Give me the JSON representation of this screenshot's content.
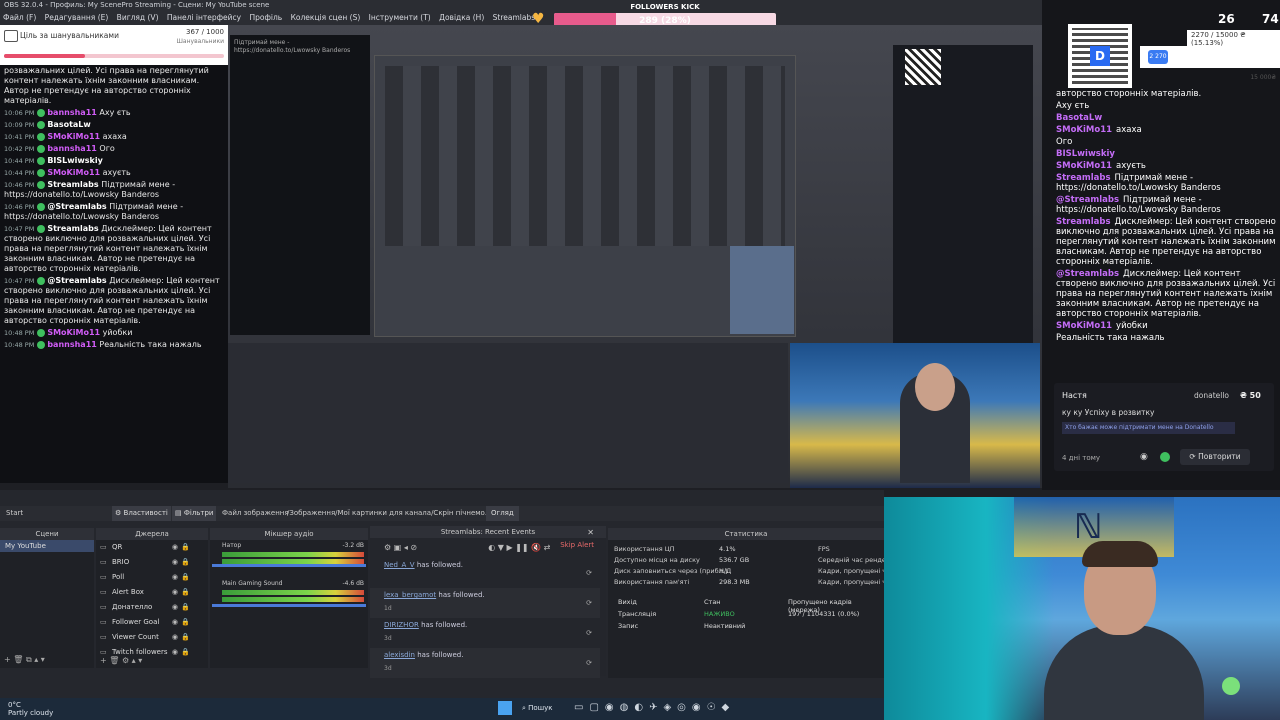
{
  "window_title": "OBS 32.0.4 - Профиль: My ScenePro Streaming - Сцени: My YouTube scene",
  "menu": [
    "Файл (F)",
    "Редагування (E)",
    "Вигляд (V)",
    "Панелі інтерфейсу",
    "Профіль",
    "Колекція сцен (S)",
    "Інструменти (T)",
    "Довідка (H)",
    "Streamlabs"
  ],
  "followers_kick": {
    "title": "FOLLOWERS KICK",
    "value": "289 (28%)",
    "min": "0",
    "max": "1000",
    "fill_fraction": 0.28
  },
  "top_right_stats": {
    "a": "26",
    "b": "74"
  },
  "donation_goal": {
    "label": "Ціль за шанувальниками",
    "count": "367 / 1000",
    "sub": "Шанувальники"
  },
  "left_chat": [
    {
      "time": "",
      "user": "",
      "text": "розважальних цілей. Усі права на переглянутий контент належать їхнім законним власникам. Автор не претендує на авторство сторонніх матеріалів.",
      "color": "#ffffff"
    },
    {
      "time": "10:06 PM",
      "user": "bannsha11",
      "text": "Аху єть",
      "color": "#d15df7"
    },
    {
      "time": "10:09 PM",
      "user": "BasotaLw",
      "text": "",
      "color": "#ffffff"
    },
    {
      "time": "10:41 PM",
      "user": "SMoKiMo11",
      "text": "ахаха",
      "color": "#d15df7"
    },
    {
      "time": "10:42 PM",
      "user": "bannsha11",
      "text": "Ого",
      "color": "#d15df7"
    },
    {
      "time": "10:44 PM",
      "user": "BISLwiwskiy",
      "text": "",
      "color": "#ffffff"
    },
    {
      "time": "10:44 PM",
      "user": "SMoKiMo11",
      "text": "ахуєть",
      "color": "#d15df7"
    },
    {
      "time": "10:46 PM",
      "user": "Streamlabs",
      "text": "Підтримай мене - https://donatello.to/Lwowsky Banderos",
      "color": "#ffffff"
    },
    {
      "time": "10:46 PM",
      "user": "@Streamlabs",
      "text": "Підтримай мене - https://donatello.to/Lwowsky Banderos",
      "color": "#ffffff"
    },
    {
      "time": "10:47 PM",
      "user": "Streamlabs",
      "text": "Дисклеймер: Цей контент створено виключно для розважальних цілей. Усі права на переглянутий контент належать їхнім законним власникам. Автор не претендує на авторство сторонніх матеріалів.",
      "color": "#ffffff"
    },
    {
      "time": "10:47 PM",
      "user": "@Streamlabs",
      "text": "Дисклеймер: Цей контент створено виключно для розважальних цілей. Усі права на переглянутий контент належать їхнім законним власникам. Автор не претендує на авторство сторонніх матеріалів.",
      "color": "#ffffff"
    },
    {
      "time": "10:48 PM",
      "user": "SMoKiMo11",
      "text": "уйобки",
      "color": "#d15df7"
    },
    {
      "time": "10:48 PM",
      "user": "bannsha11",
      "text": "Реальність така нажаль",
      "color": "#d15df7"
    }
  ],
  "right_top": {
    "progress": "2270 / 15000 ₴ (15.13%)",
    "badge": "2 270",
    "max": "15 000₴"
  },
  "right_chat": [
    {
      "user": "",
      "text": "авторство сторонніх матеріалів."
    },
    {
      "user": "",
      "text": "Аху єть"
    },
    {
      "user": "BasotaLw",
      "text": ""
    },
    {
      "user": "SMoKiMo11",
      "text": "ахаха"
    },
    {
      "user": "",
      "text": "Ого"
    },
    {
      "user": "BISLwiwskiy",
      "text": ""
    },
    {
      "user": "SMoKiMo11",
      "text": "ахуєть"
    },
    {
      "user": "Streamlabs",
      "text": "Підтримай мене - https://donatello.to/Lwowsky Banderos"
    },
    {
      "user": "@Streamlabs",
      "text": "Підтримай мене - https://donatello.to/Lwowsky Banderos"
    },
    {
      "user": "Streamlabs",
      "text": "Дисклеймер: Цей контент створено виключно для розважальних цілей. Усі права на переглянутий контент належать їхнім законним власникам. Автор не претендує на авторство сторонніх матеріалів."
    },
    {
      "user": "@Streamlabs",
      "text": "Дисклеймер: Цей контент створено виключно для розважальних цілей. Усі права на переглянутий контент належать їхнім законним власникам. Автор не претендує на авторство сторонніх матеріалів."
    },
    {
      "user": "SMoKiMo11",
      "text": "уйобки"
    },
    {
      "user": "",
      "text": "Реальність така нажаль"
    }
  ],
  "donation_card": {
    "name": "Настя",
    "source": "donatello",
    "amount": "₴ 50",
    "message": "ку ку Успіху в розвитку",
    "hint": "Хто бажає може підтримати мене на Donatello",
    "age": "4 дні тому",
    "repeat": "Повторити"
  },
  "obs_toolbar": {
    "start": "Start",
    "properties": "Властивості",
    "filters": "Фільтри",
    "image_file": "Файл зображення",
    "path": "/Зображення/Мої картинки для канала/Скрін пічнемо.png",
    "browse": "Огляд"
  },
  "scenes": {
    "header": "Сцени",
    "items": [
      "My YouTube"
    ]
  },
  "sources": {
    "header": "Джерела",
    "items": [
      "QR",
      "BRIO",
      "Poll",
      "Alert Box",
      "Донателло",
      "Follower Goal",
      "Viewer Count",
      "Twitch followers"
    ]
  },
  "mixer": {
    "header": "Мікшер аудіо",
    "ch1": "Натор",
    "ch1_db": "-3.2 dB",
    "ch2": "Main Gaming Sound",
    "ch2_db": "-4.6 dB"
  },
  "events": {
    "header": "Streamlabs: Recent Events",
    "skip": "Skip Alert",
    "items": [
      {
        "user": "Ned_A_V",
        "action": "has followed.",
        "age": ""
      },
      {
        "user": "lexa_bergamot",
        "action": "has followed.",
        "age": "1d"
      },
      {
        "user": "DIRIZHOR",
        "action": "has followed.",
        "age": "3d"
      },
      {
        "user": "alexisdin",
        "action": "has followed.",
        "age": "3d"
      }
    ]
  },
  "stats": {
    "header": "Статистика",
    "rows": [
      {
        "label": "Використання ЦП",
        "value": "4.1%"
      },
      {
        "label": "Доступно місця на диску",
        "value": "536.7 GB"
      },
      {
        "label": "Диск заповниться через (прибл.)",
        "value": "Н/Д"
      },
      {
        "label": "Використання пам'яті",
        "value": "298.3 MB"
      }
    ],
    "right": [
      {
        "label": "FPS",
        "value": ""
      },
      {
        "label": "Середній час рендер",
        "value": ""
      },
      {
        "label": "Кадри, пропущені че",
        "value": ""
      },
      {
        "label": "Кадри, пропущені че",
        "value": ""
      }
    ],
    "table_headers": [
      "Вихід",
      "Стан",
      "Пропущено кадрів (мережа)"
    ],
    "table_rows": [
      [
        "Трансляція",
        "НАЖИВО",
        "197 / 1104331 (0.0%)"
      ],
      [
        "Запис",
        "Неактивний",
        ""
      ]
    ]
  },
  "weather": {
    "temp": "0°C",
    "desc": "Partly cloudy"
  },
  "taskbar_search": "Пошук"
}
